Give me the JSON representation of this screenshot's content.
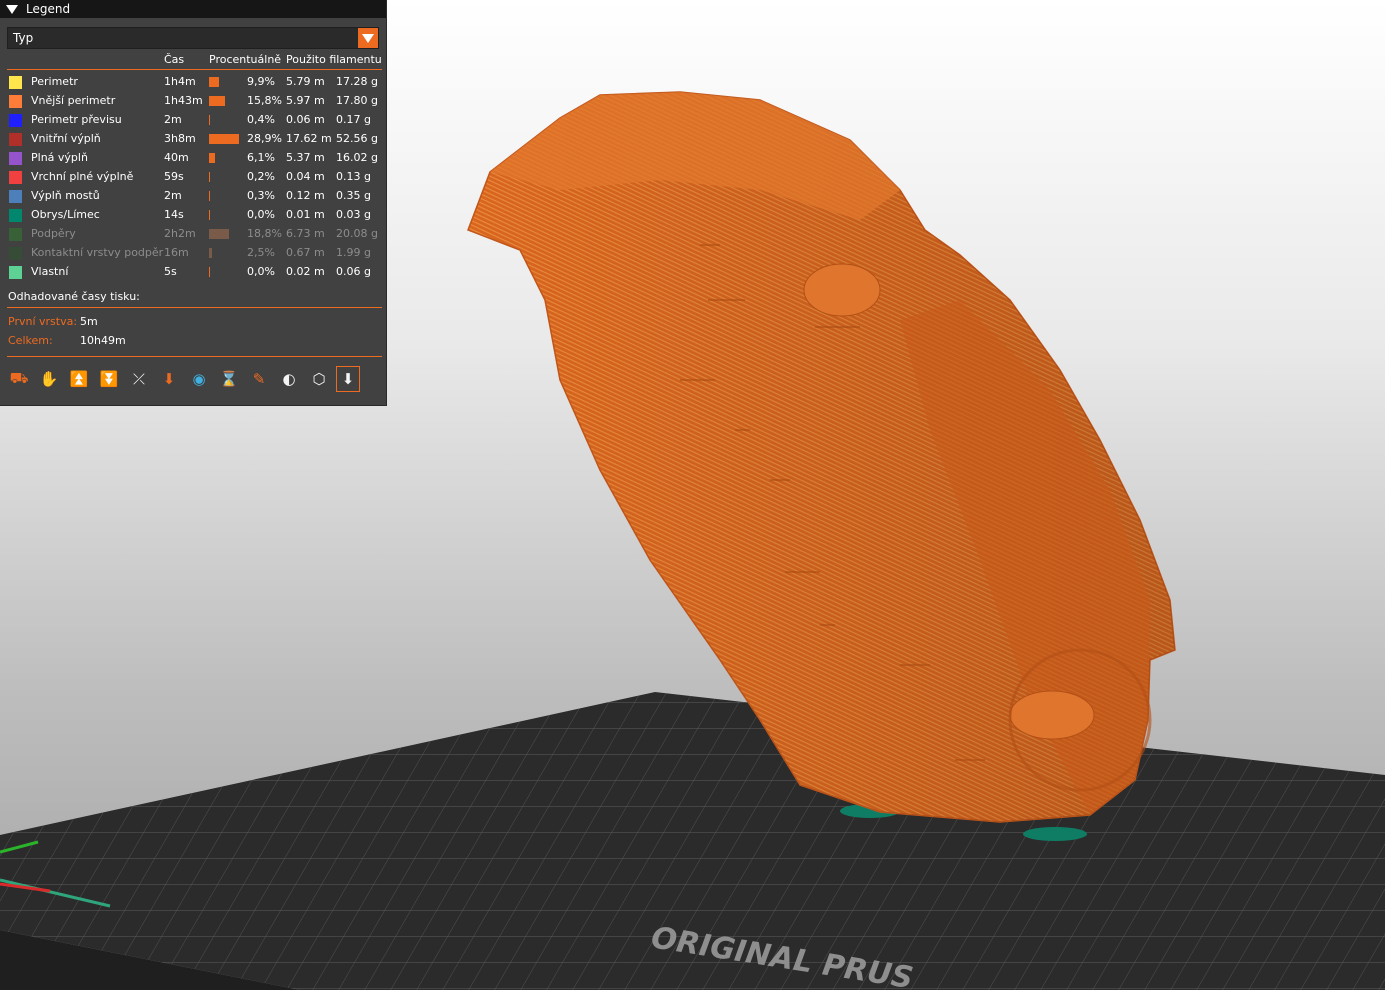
{
  "legend": {
    "title": "Legend",
    "view_type": "Typ",
    "columns": {
      "time": "Čas",
      "percent": "Procentuálně",
      "filament": "Použito filamentu"
    },
    "items": [
      {
        "label": "Perimetr",
        "color": "#FFE64D",
        "time": "1h4m",
        "percent": "9,9%",
        "length": "5.79 m",
        "weight": "17.28 g",
        "share": 0.099,
        "visible": true
      },
      {
        "label": "Vnější perimetr",
        "color": "#FF7D38",
        "time": "1h43m",
        "percent": "15,8%",
        "length": "5.97 m",
        "weight": "17.80 g",
        "share": 0.158,
        "visible": true
      },
      {
        "label": "Perimetr převisu",
        "color": "#1F1FFF",
        "time": "2m",
        "percent": "0,4%",
        "length": "0.06 m",
        "weight": "0.17 g",
        "share": 0.004,
        "visible": true
      },
      {
        "label": "Vnitřní výplň",
        "color": "#B03029",
        "time": "3h8m",
        "percent": "28,9%",
        "length": "17.62 m",
        "weight": "52.56 g",
        "share": 0.289,
        "visible": true
      },
      {
        "label": "Plná výplň",
        "color": "#9654CC",
        "time": "40m",
        "percent": "6,1%",
        "length": "5.37 m",
        "weight": "16.02 g",
        "share": 0.061,
        "visible": true
      },
      {
        "label": "Vrchní plné výplně",
        "color": "#F04040",
        "time": "59s",
        "percent": "0,2%",
        "length": "0.04 m",
        "weight": "0.13 g",
        "share": 0.002,
        "visible": true
      },
      {
        "label": "Výplň mostů",
        "color": "#4D80BA",
        "time": "2m",
        "percent": "0,3%",
        "length": "0.12 m",
        "weight": "0.35 g",
        "share": 0.003,
        "visible": true
      },
      {
        "label": "Obrys/Límec",
        "color": "#00876E",
        "time": "14s",
        "percent": "0,0%",
        "length": "0.01 m",
        "weight": "0.03 g",
        "share": 0.0,
        "visible": true
      },
      {
        "label": "Podpěry",
        "color": "#2E8A2E",
        "time": "2h2m",
        "percent": "18,8%",
        "length": "6.73 m",
        "weight": "20.08 g",
        "share": 0.188,
        "visible": false
      },
      {
        "label": "Kontaktní vrstvy podpěr",
        "color": "#2A5C2A",
        "time": "16m",
        "percent": "2,5%",
        "length": "0.67 m",
        "weight": "1.99 g",
        "share": 0.025,
        "visible": false
      },
      {
        "label": "Vlastní",
        "color": "#5ED194",
        "time": "5s",
        "percent": "0,0%",
        "length": "0.02 m",
        "weight": "0.06 g",
        "share": 0.0,
        "visible": true
      }
    ],
    "estimated_label": "Odhadované časy tisku:",
    "first_layer_label": "První vrstva:",
    "first_layer_value": "5m",
    "total_label": "Celkem:",
    "total_value": "10h49m",
    "tools": [
      "travel-icon",
      "wipe-icon",
      "retractions-icon",
      "deretractions-icon",
      "seams-icon",
      "tool-changes-icon",
      "color-changes-icon",
      "pause-icon",
      "custom-gcode-icon",
      "center-of-gravity-icon",
      "shells-icon",
      "tool-marker-icon"
    ]
  },
  "bed": {
    "brand_text": "ORIGINAL PRUS"
  },
  "colors": {
    "accent": "#ED6B21",
    "model": "#D9651F",
    "panel": "#414141",
    "bed": "#2b2b2b"
  }
}
